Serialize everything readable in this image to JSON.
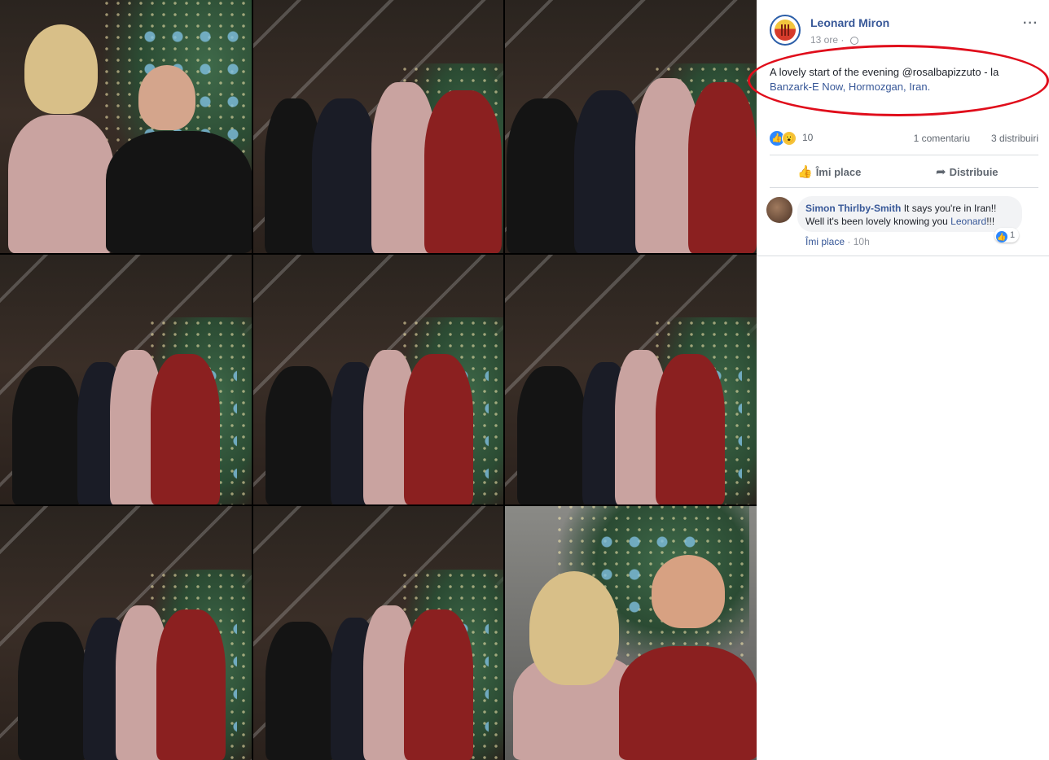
{
  "post": {
    "author": "Leonard Miron",
    "time": "13 ore",
    "privacy_icon": "globe-icon",
    "more_icon": "···",
    "text_prefix": "A lovely start of the evening @rosalbapizzuto",
    "text_suffix": " - la",
    "location": "Banzark-E Now, Hormozgan, Iran.",
    "reactions": {
      "like_icon": "👍",
      "wow_icon": "😮",
      "count": "10"
    },
    "comment_count": "1 comentariu",
    "share_count": "3 distribuiri",
    "actions": {
      "like_label": "Îmi place",
      "share_label": "Distribuie"
    }
  },
  "comment": {
    "author": "Simon Thirlby-Smith",
    "text_line1": "It says you're in Iran!!",
    "text_line2_prefix": "Well it's been lovely knowing you",
    "tag": "Leonard",
    "text_line2_suffix": "!!!",
    "like_count": "1",
    "like_label": "Îmi place",
    "time": "10h"
  },
  "accent": {
    "link": "#385898",
    "highlight_oval": "#e00d1b",
    "like_blue": "#2d88ff"
  }
}
